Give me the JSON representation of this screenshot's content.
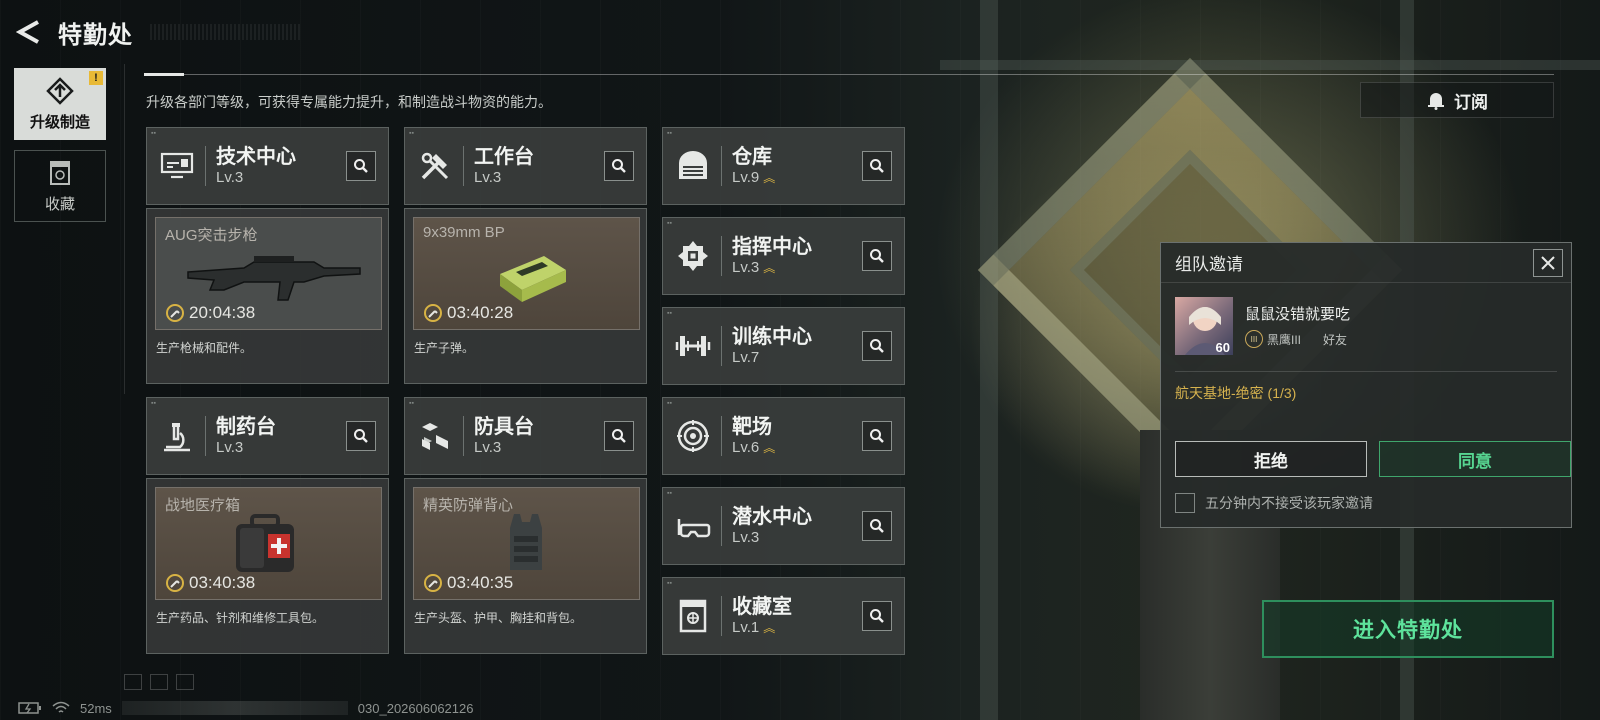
{
  "header": {
    "title": "特勤处"
  },
  "nav": [
    {
      "label": "升级制造",
      "icon": "upgrade-icon",
      "active": true,
      "badge": "!"
    },
    {
      "label": "收藏",
      "icon": "collection-icon",
      "active": false
    }
  ],
  "subtitle": "升级各部门等级，可获得专属能力提升，和制造战斗物资的能力。",
  "subscribe": {
    "label": "订阅",
    "icon": "bell-icon"
  },
  "production_facilities": [
    {
      "name": "技术中心",
      "level": "Lv.3",
      "icon": "monitor-icon",
      "product": "AUG突击步枪",
      "timer": "20:04:38",
      "desc": "生产枪械和配件。"
    },
    {
      "name": "工作台",
      "level": "Lv.3",
      "icon": "tools-icon",
      "product": "9x39mm BP",
      "timer": "03:40:28",
      "desc": "生产子弹。"
    },
    {
      "name": "制药台",
      "level": "Lv.3",
      "icon": "microscope-icon",
      "product": "战地医疗箱",
      "timer": "03:40:38",
      "desc": "生产药品、针剂和维修工具包。"
    },
    {
      "name": "防具台",
      "level": "Lv.3",
      "icon": "blocks-icon",
      "product": "精英防弹背心",
      "timer": "03:40:35",
      "desc": "生产头盔、护甲、胸挂和背包。"
    }
  ],
  "facilities": [
    {
      "name": "仓库",
      "level": "Lv.9",
      "icon": "warehouse-icon",
      "upgradable": true
    },
    {
      "name": "指挥中心",
      "level": "Lv.3",
      "icon": "command-icon",
      "upgradable": true
    },
    {
      "name": "训练中心",
      "level": "Lv.7",
      "icon": "dumbbell-icon",
      "upgradable": false
    },
    {
      "name": "靶场",
      "level": "Lv.6",
      "icon": "target-icon",
      "upgradable": true
    },
    {
      "name": "潜水中心",
      "level": "Lv.3",
      "icon": "goggles-icon",
      "upgradable": false
    },
    {
      "name": "收藏室",
      "level": "Lv.1",
      "icon": "vault-icon",
      "upgradable": true
    }
  ],
  "invite": {
    "title": "组队邀请",
    "user_name": "鼠鼠没错就要吃",
    "user_level": "60",
    "rank": "黑鹰III",
    "relation": "好友",
    "mission": "航天基地-绝密 (1/3)",
    "reject_label": "拒绝",
    "accept_label": "同意",
    "mute_label": "五分钟内不接受该玩家邀请"
  },
  "enter_button": "进入特勤处",
  "status_bar": {
    "ping": "52ms",
    "build_suffix": "030_202606062126"
  },
  "colors": {
    "accent_green": "#57d591",
    "accent_gold": "#d6b24e",
    "panel": "#3a3d3c"
  }
}
